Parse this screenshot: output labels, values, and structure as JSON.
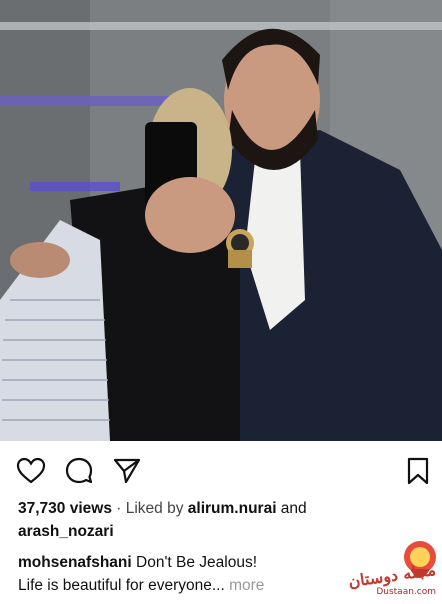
{
  "post": {
    "views": "37,730 views",
    "liked_by_prefix": "· Liked by ",
    "liked_by_user1": "alirum.nurai",
    "liked_by_and": " and",
    "liked_by_user2": "arash_nozari",
    "username": "mohsenafshani",
    "caption_line1": " Don't Be Jealous!",
    "caption_line2": "Life is beautiful for everyone...",
    "more": " more"
  },
  "icons": {
    "like": "heart-outline",
    "comment": "speech-bubble",
    "share": "paper-plane",
    "save": "bookmark-outline"
  },
  "watermark": {
    "logo_text": "مجله دوستان",
    "site": "Dustaan.com"
  },
  "colors": {
    "accent": "#c0392b",
    "muted": "#9a9a9a"
  }
}
